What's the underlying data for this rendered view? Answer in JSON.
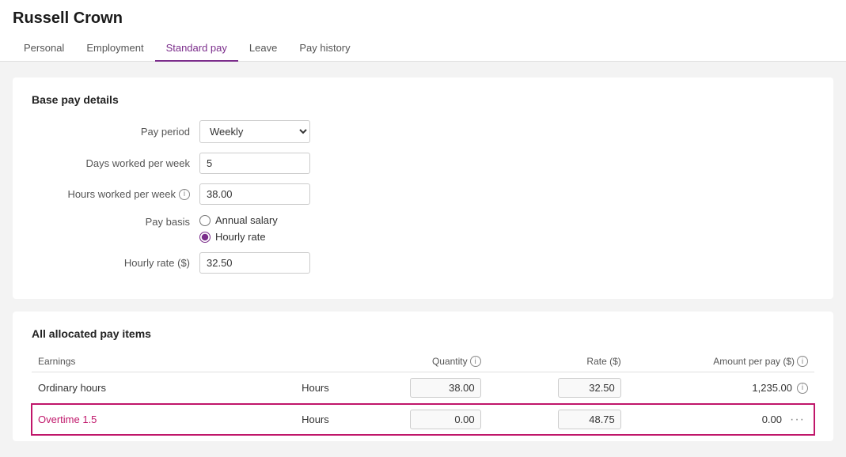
{
  "page": {
    "title": "Russell Crown"
  },
  "tabs": [
    {
      "id": "personal",
      "label": "Personal",
      "active": false
    },
    {
      "id": "employment",
      "label": "Employment",
      "active": false
    },
    {
      "id": "standard-pay",
      "label": "Standard pay",
      "active": true
    },
    {
      "id": "leave",
      "label": "Leave",
      "active": false
    },
    {
      "id": "pay-history",
      "label": "Pay history",
      "active": false
    }
  ],
  "base_pay": {
    "section_title": "Base pay details",
    "pay_period_label": "Pay period",
    "pay_period_value": "Weekly",
    "days_worked_label": "Days worked per week",
    "days_worked_value": "5",
    "hours_worked_label": "Hours worked per week",
    "hours_worked_value": "38.00",
    "pay_basis_label": "Pay basis",
    "pay_basis_options": [
      {
        "id": "annual",
        "label": "Annual salary",
        "checked": false
      },
      {
        "id": "hourly",
        "label": "Hourly rate",
        "checked": true
      }
    ],
    "hourly_rate_label": "Hourly rate ($)",
    "hourly_rate_value": "32.50"
  },
  "pay_items": {
    "section_title": "All allocated pay items",
    "columns": {
      "earnings": "Earnings",
      "quantity": "Quantity",
      "rate": "Rate ($)",
      "amount": "Amount per pay ($)"
    },
    "rows": [
      {
        "id": "ordinary",
        "label": "Ordinary hours",
        "unit": "Hours",
        "quantity": "38.00",
        "rate": "32.50",
        "amount": "1,235.00",
        "highlighted": false
      },
      {
        "id": "overtime",
        "label": "Overtime 1.5",
        "unit": "Hours",
        "quantity": "0.00",
        "rate": "48.75",
        "amount": "0.00",
        "highlighted": true
      }
    ]
  }
}
